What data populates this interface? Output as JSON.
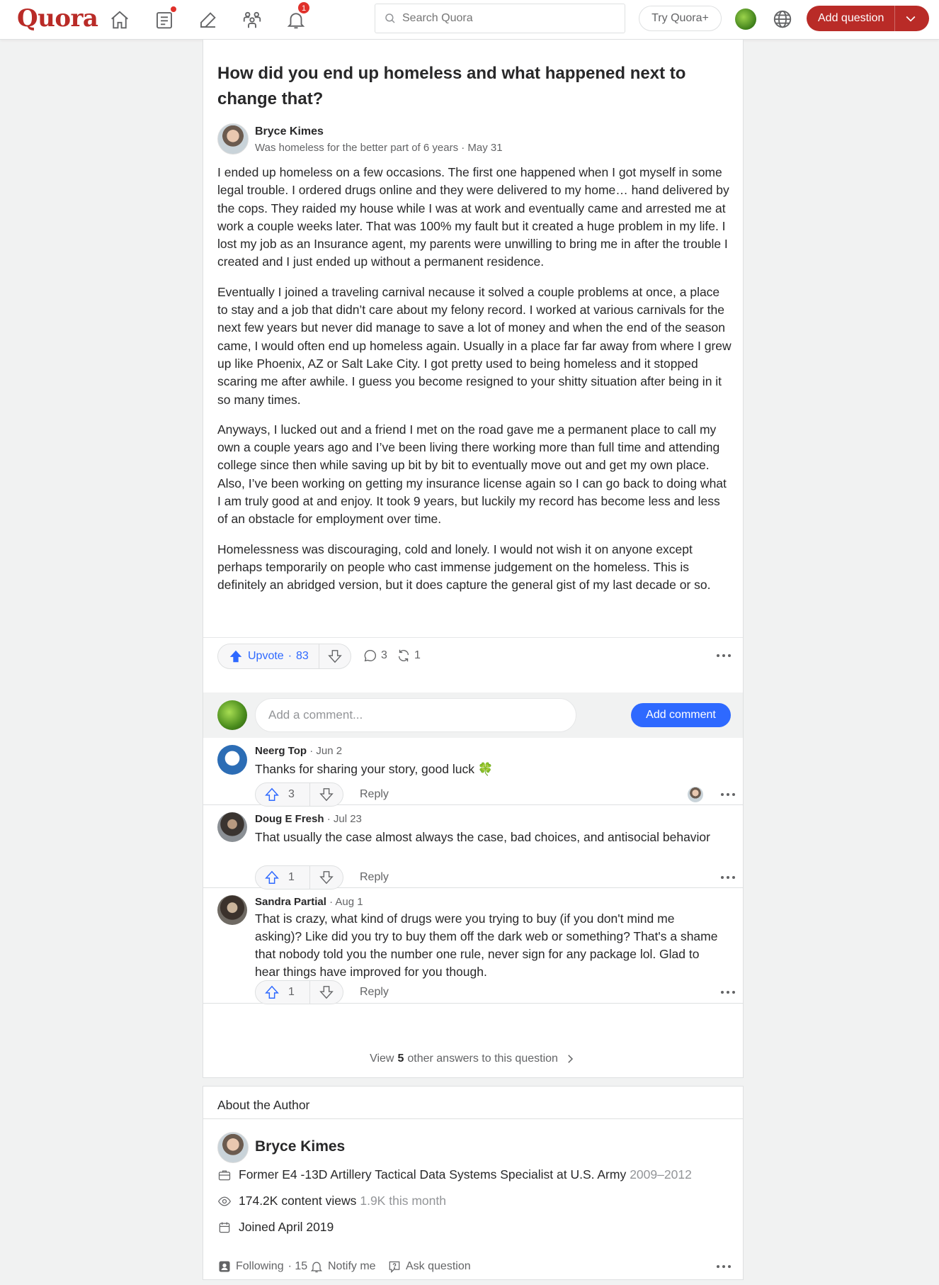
{
  "nav": {
    "logo": "Quora",
    "notifications_count": "1",
    "search_placeholder": "Search Quora",
    "try_plus": "Try Quora+",
    "add_question": "Add question"
  },
  "question": {
    "title": "How did you end up homeless and what happened next to change that?"
  },
  "answer": {
    "author_name": "Bryce Kimes",
    "author_credential": "Was homeless for the better part of 6 years · May 31",
    "paragraphs": [
      "I ended up homeless on a few occasions. The first one happened when I got myself in some legal trouble. I ordered drugs online and they were delivered to my home… hand delivered by the cops. They raided my house while I was at work and eventually came and arrested me at work a couple weeks later. That was 100% my fault but it created a huge problem in my life. I lost my job as an Insurance agent, my parents were unwilling to bring me in after the trouble I created and I just ended up without a permanent residence.",
      "Eventually I joined a traveling carnival necause it solved a couple problems at once, a place to stay and a job that didn’t care about my felony record. I worked at various carnivals for the next few years but never did manage to save a lot of money and when the end of the season came, I would often end up homeless again. Usually in a place far far away from where I grew up like Phoenix, AZ or Salt Lake City. I got pretty used to being homeless and it stopped scaring me after awhile. I guess you become resigned to your shitty situation after being in it so many times.",
      "Anyways, I lucked out and a friend I met on the road gave me a permanent place to call my own a couple years ago and I’ve been living there working more than full time and attending college since then while saving up bit by bit to eventually move out and get my own place. Also, I’ve been working on getting my insurance license again so I can go back to doing what I am truly good at and enjoy. It took 9 years, but luckily my record has become less and less of an obstacle for employment over time.",
      "Homelessness was discouraging, cold and lonely. I would not wish it on anyone except perhaps temporarily on people who cast immense judgement on the homeless. This is definitely an abridged version, but it does capture the general gist of my last decade or so."
    ],
    "upvote_label": "Upvote",
    "upvote_count": "83",
    "comment_count": "3",
    "share_count": "1"
  },
  "comment_box": {
    "placeholder": "Add a comment...",
    "button": "Add comment"
  },
  "comments": [
    {
      "name": "Neerg Top",
      "date": "· Jun 2",
      "text": "Thanks for sharing your story, good luck 🍀",
      "upvotes": "3",
      "reply": "Reply"
    },
    {
      "name": "Doug E Fresh",
      "date": "· Jul 23",
      "text": "That usually the case almost always the case, bad choices, and antisocial behavior",
      "upvotes": "1",
      "reply": "Reply"
    },
    {
      "name": "Sandra Partial",
      "date": "· Aug 1",
      "text": "That is crazy, what kind of drugs were you trying to buy (if you don't mind me asking)? Like did you try to buy them off the dark web or something? That's a shame that nobody told you the number one rule, never sign for any package lol. Glad to hear things have improved for you though.",
      "upvotes": "1",
      "reply": "Reply"
    }
  ],
  "view_more": {
    "prefix": "View",
    "count": "5",
    "suffix": "other answers to this question"
  },
  "about": {
    "heading": "About the Author",
    "name": "Bryce Kimes",
    "employment": "Former E4 -13D Artillery Tactical Data Systems Specialist at U.S. Army",
    "employment_years": "2009–2012",
    "views": "174.2K content views",
    "views_month": "1.9K this month",
    "joined": "Joined April 2019",
    "following_label": "Following",
    "following_count": "· 15",
    "notify": "Notify me",
    "ask": "Ask question"
  },
  "colors": {
    "brand": "#b92b27",
    "accent_blue": "#2e69ff",
    "text": "#282829",
    "muted": "#636466"
  }
}
